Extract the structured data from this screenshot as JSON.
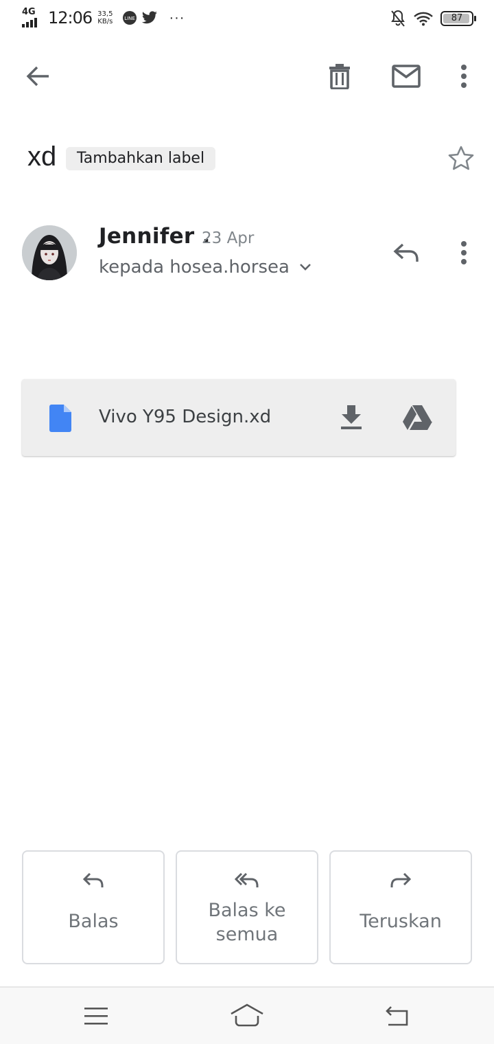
{
  "status_bar": {
    "network": "4G",
    "time": "12:06",
    "speed_value": "33,5",
    "speed_unit": "KB/s",
    "notification_icons": [
      "line-icon",
      "twitter-icon"
    ],
    "overflow": "···",
    "battery": "87"
  },
  "app_bar": {
    "icons": [
      "back-arrow-icon",
      "delete-icon",
      "mark-unread-icon",
      "more-vert-icon"
    ]
  },
  "message": {
    "subject": "xd",
    "label_chip": "Tambahkan label",
    "sender_name": "Jennifer .",
    "date": "23 Apr",
    "recipient": "kepada hosea.horsea"
  },
  "attachment": {
    "file_name": "Vivo Y95 Design.xd",
    "icon_color": "#4285f4"
  },
  "actions": {
    "reply": "Balas",
    "reply_all_line1": "Balas ke",
    "reply_all_line2": "semua",
    "forward": "Teruskan"
  },
  "nav_bar": {
    "icons": [
      "menu-icon",
      "home-icon",
      "back-icon"
    ]
  },
  "colors": {
    "icon_gray": "#5f6368",
    "chip_bg": "#eeeeee",
    "date_gray": "#80868b"
  }
}
